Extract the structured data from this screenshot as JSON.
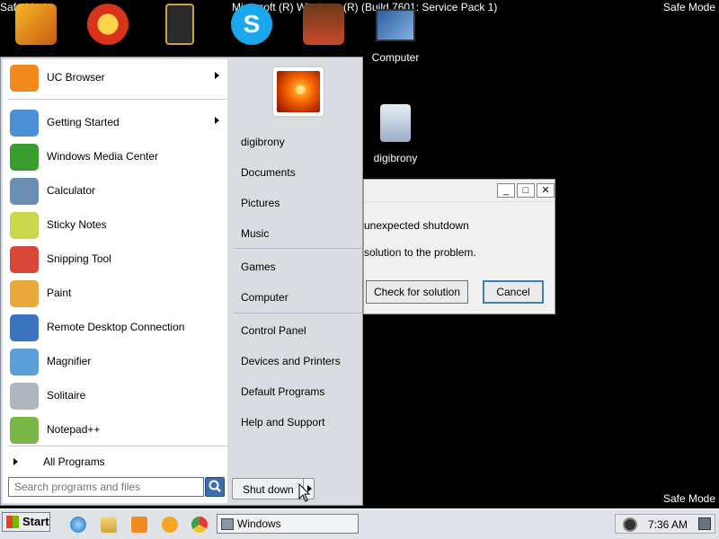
{
  "desktop": {
    "safe_mode_label": "Safe Mode",
    "title_text": "Microsoft (R) Windows (R) (Build 7601: Service Pack 1)",
    "icons": [
      {
        "name": "Zuma",
        "label": ""
      },
      {
        "name": "Pacman",
        "label": ""
      },
      {
        "name": "LoL",
        "label": ""
      },
      {
        "name": "Skype",
        "label": ""
      },
      {
        "name": "Angry Birds Seasons",
        "label": ""
      },
      {
        "name": "Computer",
        "label": "Computer"
      },
      {
        "name": "digibrony",
        "label": "digibrony"
      }
    ]
  },
  "dialog": {
    "message_line1": "unexpected shutdown",
    "message_line2": "solution to the problem.",
    "check_button": "Check for solution",
    "cancel_button": "Cancel",
    "min_glyph": "_",
    "max_glyph": "□",
    "close_glyph": "✕"
  },
  "start_menu": {
    "programs": [
      {
        "label": "UC Browser",
        "submenu": true,
        "color": "#f08a1e"
      },
      {
        "label": "Getting Started",
        "submenu": true,
        "color": "#4b8fd6"
      },
      {
        "label": "Windows Media Center",
        "submenu": false,
        "color": "#3a9b2e"
      },
      {
        "label": "Calculator",
        "submenu": false,
        "color": "#6b8fb3"
      },
      {
        "label": "Sticky Notes",
        "submenu": false,
        "color": "#c9d84a"
      },
      {
        "label": "Snipping Tool",
        "submenu": false,
        "color": "#d9473a"
      },
      {
        "label": "Paint",
        "submenu": false,
        "color": "#e9a93a"
      },
      {
        "label": "Remote Desktop Connection",
        "submenu": false,
        "color": "#3a74c0"
      },
      {
        "label": "Magnifier",
        "submenu": false,
        "color": "#5aa0d8"
      },
      {
        "label": "Solitaire",
        "submenu": false,
        "color": "#b0b6bd"
      },
      {
        "label": "Notepad++",
        "submenu": false,
        "color": "#7ab648"
      }
    ],
    "all_programs": "All Programs",
    "search_placeholder": "Search programs and files",
    "right_links": [
      "digibrony",
      "Documents",
      "Pictures",
      "Music",
      "Games",
      "Computer",
      "Control Panel",
      "Devices and Printers",
      "Default Programs",
      "Help and Support"
    ],
    "shutdown_label": "Shut down"
  },
  "taskbar": {
    "start_label": "Start",
    "window_button": "Windows",
    "clock": "7:36 AM",
    "quick_launch": [
      "internet-explorer",
      "explorer",
      "media-player",
      "uc-browser",
      "chrome"
    ]
  }
}
